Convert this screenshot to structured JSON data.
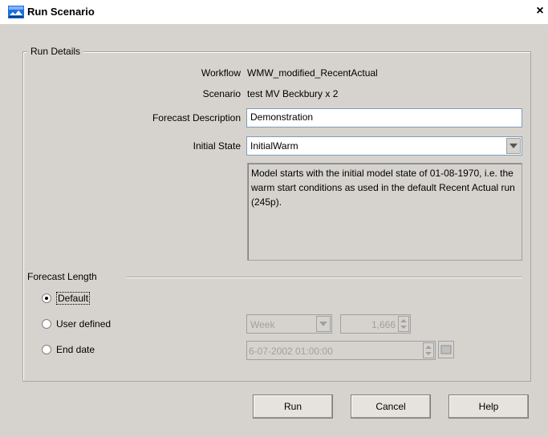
{
  "window": {
    "title": "Run Scenario",
    "close_symbol": "×"
  },
  "run_details": {
    "legend": "Run Details",
    "workflow_label": "Workflow",
    "workflow_value": "WMW_modified_RecentActual",
    "scenario_label": "Scenario",
    "scenario_value": "test MV Beckbury x 2",
    "forecast_description_label": "Forecast Description",
    "forecast_description_value": "Demonstration",
    "initial_state_label": "Initial State",
    "initial_state_value": "InitialWarm",
    "initial_state_description": "Model starts with the initial model state of 01-08-1970, i.e. the warm start conditions as used in the default Recent Actual run (245p)."
  },
  "forecast_length": {
    "label": "Forecast Length",
    "options": [
      {
        "label": "Default",
        "selected": true
      },
      {
        "label": "User defined",
        "selected": false
      },
      {
        "label": "End date",
        "selected": false
      }
    ],
    "unit_value": "Week",
    "count_value": "1,666",
    "end_date_value": "6-07-2002 01:00:00"
  },
  "buttons": {
    "run": "Run",
    "cancel": "Cancel",
    "help": "Help"
  },
  "colors": {
    "title_icon": "#1e6fd9",
    "background": "#d6d3ce",
    "field_border": "#7f9db9"
  },
  "icons": {
    "app": "run-scenario-app-icon",
    "close": "close-icon",
    "dropdown": "chevron-down-icon",
    "spinner": "spinner-icon",
    "calendar": "calendar-icon"
  }
}
